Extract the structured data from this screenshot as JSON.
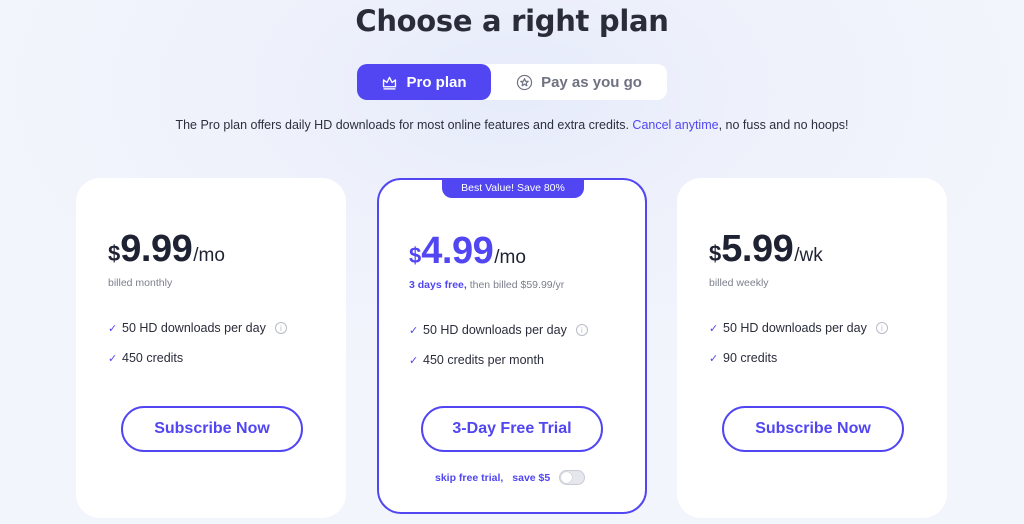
{
  "header": {
    "title": "Choose a right plan",
    "tabs": [
      {
        "label": "Pro plan",
        "icon": "crown-icon",
        "active": true
      },
      {
        "label": "Pay as you go",
        "icon": "star-circle-icon",
        "active": false
      }
    ],
    "description": "The Pro plan offers daily HD downloads for most online features and extra credits.",
    "description_link": "Cancel anytime",
    "description_tail": ", no fuss and no hoops!"
  },
  "plans": [
    {
      "currency": "$",
      "amount": "9.99",
      "period": "/mo",
      "billed": "billed monthly",
      "features": [
        "50 HD downloads per day",
        "450 credits"
      ],
      "button": "Subscribe Now"
    },
    {
      "badge": "Best Value! Save 80%",
      "currency": "$",
      "amount": "4.99",
      "period": "/mo",
      "billed_highlight": "3 days free,",
      "billed": " then billed $59.99/yr",
      "features": [
        "50 HD downloads per day",
        "450 credits per month"
      ],
      "button": "3-Day Free Trial",
      "skip_label": "skip free trial,",
      "save_label": "save $5",
      "skip_toggle_on": false
    },
    {
      "currency": "$",
      "amount": "5.99",
      "period": "/wk",
      "billed": "billed weekly",
      "features": [
        "50 HD downloads per day",
        "90 credits"
      ],
      "button": "Subscribe Now"
    }
  ],
  "colors": {
    "accent": "#5146f2",
    "text": "#1f2233",
    "muted": "#7c7f8c"
  },
  "icons": {
    "check": "✓",
    "info": "i"
  }
}
